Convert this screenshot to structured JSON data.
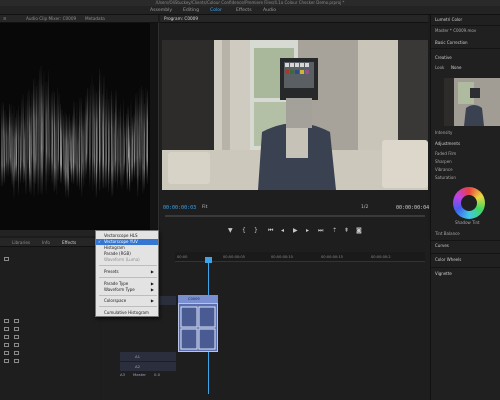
{
  "window": {
    "title": "/Users/OliStuckey/Clients/Colour Confidence/Premiere Files/4.1a Colour Checker Demo.prproj *"
  },
  "workspaces": [
    {
      "label": "Assembly",
      "active": false
    },
    {
      "label": "Editing",
      "active": false
    },
    {
      "label": "Color",
      "active": true
    },
    {
      "label": "Effects",
      "active": false
    },
    {
      "label": "Audio",
      "active": false
    }
  ],
  "scope_panel": {
    "tabs": [
      "Audio Clip Mixer: C0009",
      "Metadata"
    ]
  },
  "program": {
    "tab": "Program: C0009",
    "timecode_current": "00:00:00:03",
    "fit": "Fit",
    "quality": "1/2",
    "timecode_duration": "00:00:00:04",
    "controls": [
      "marker",
      "in",
      "out",
      "go-in",
      "step-back",
      "play",
      "step-forward",
      "go-out",
      "lift",
      "extract",
      "export-frame"
    ]
  },
  "lumetri": {
    "tab": "Lumetri Color",
    "master": "Master * C0009.mov",
    "seq": "C0009 * C",
    "sections": {
      "basic": "Basic Correction",
      "creative": "Creative",
      "look_label": "Look",
      "look_value": "None",
      "intensity": "Intensity",
      "adjustments": "Adjustments",
      "faded_film": "Faded Film",
      "sharpen": "Sharpen",
      "vibrance": "Vibrance",
      "saturation": "Saturation",
      "shadow_tint": "Shadow Tint",
      "tint_balance": "Tint Balance",
      "curves": "Curves",
      "color_wheels": "Color Wheels",
      "vignette": "Vignette"
    },
    "colors": {
      "wheel_ring": "#c64bd9"
    }
  },
  "bottom_left": {
    "tabs": [
      "Libraries",
      "Info",
      "Effects"
    ]
  },
  "timeline": {
    "timecodes": [
      "00:00",
      "00:00:00:05",
      "00:00:00:10",
      "00:00:00:15",
      "00:00:00:2"
    ],
    "clip_name": "C0009",
    "tracks": [
      "V1",
      "A1",
      "A2",
      "A3",
      "Master"
    ],
    "master_value": "0.0"
  },
  "menu": {
    "items": [
      {
        "label": "Vectorscope HLS",
        "state": "normal"
      },
      {
        "label": "Vectorscope YUV",
        "state": "selected"
      },
      {
        "label": "Histogram",
        "state": "normal"
      },
      {
        "label": "Parade (RGB)",
        "state": "normal"
      },
      {
        "label": "Waveform (Luma)",
        "state": "disabled"
      }
    ],
    "submenus": [
      {
        "label": "Presets"
      },
      {
        "label": "Parade Type"
      },
      {
        "label": "Waveform Type"
      },
      {
        "label": "Colorspace"
      }
    ],
    "footer": "Cumulative Histogram",
    "colors": {
      "highlight": "#3476d2",
      "background": "#e3e3e3"
    }
  }
}
